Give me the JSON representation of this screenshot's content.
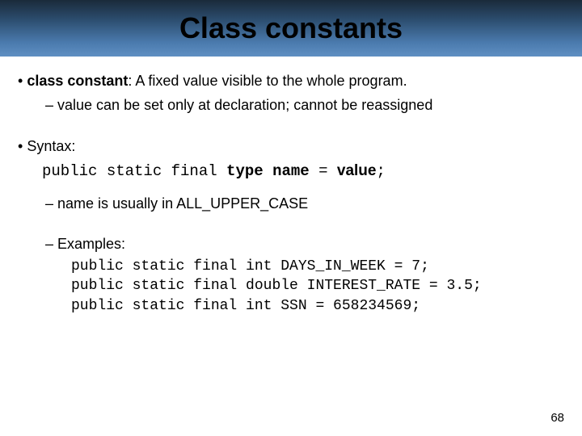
{
  "title": "Class constants",
  "bullets": {
    "def_label": "class constant",
    "def_rest": ": A fixed value visible to the whole program.",
    "sub1": "value can be set only at declaration;  cannot be reassigned",
    "syntax_label": "Syntax:",
    "syntax_prefix": "public static final ",
    "syntax_type": "type",
    "syntax_name": "name",
    "syntax_eq": " = ",
    "syntax_value": "value",
    "syntax_semi": ";",
    "sub2": "name is usually in ALL_UPPER_CASE",
    "sub3": "Examples:",
    "examples": "public static final int DAYS_IN_WEEK = 7;\npublic static final double INTEREST_RATE = 3.5;\npublic static final int SSN = 658234569;"
  },
  "page_number": "68"
}
